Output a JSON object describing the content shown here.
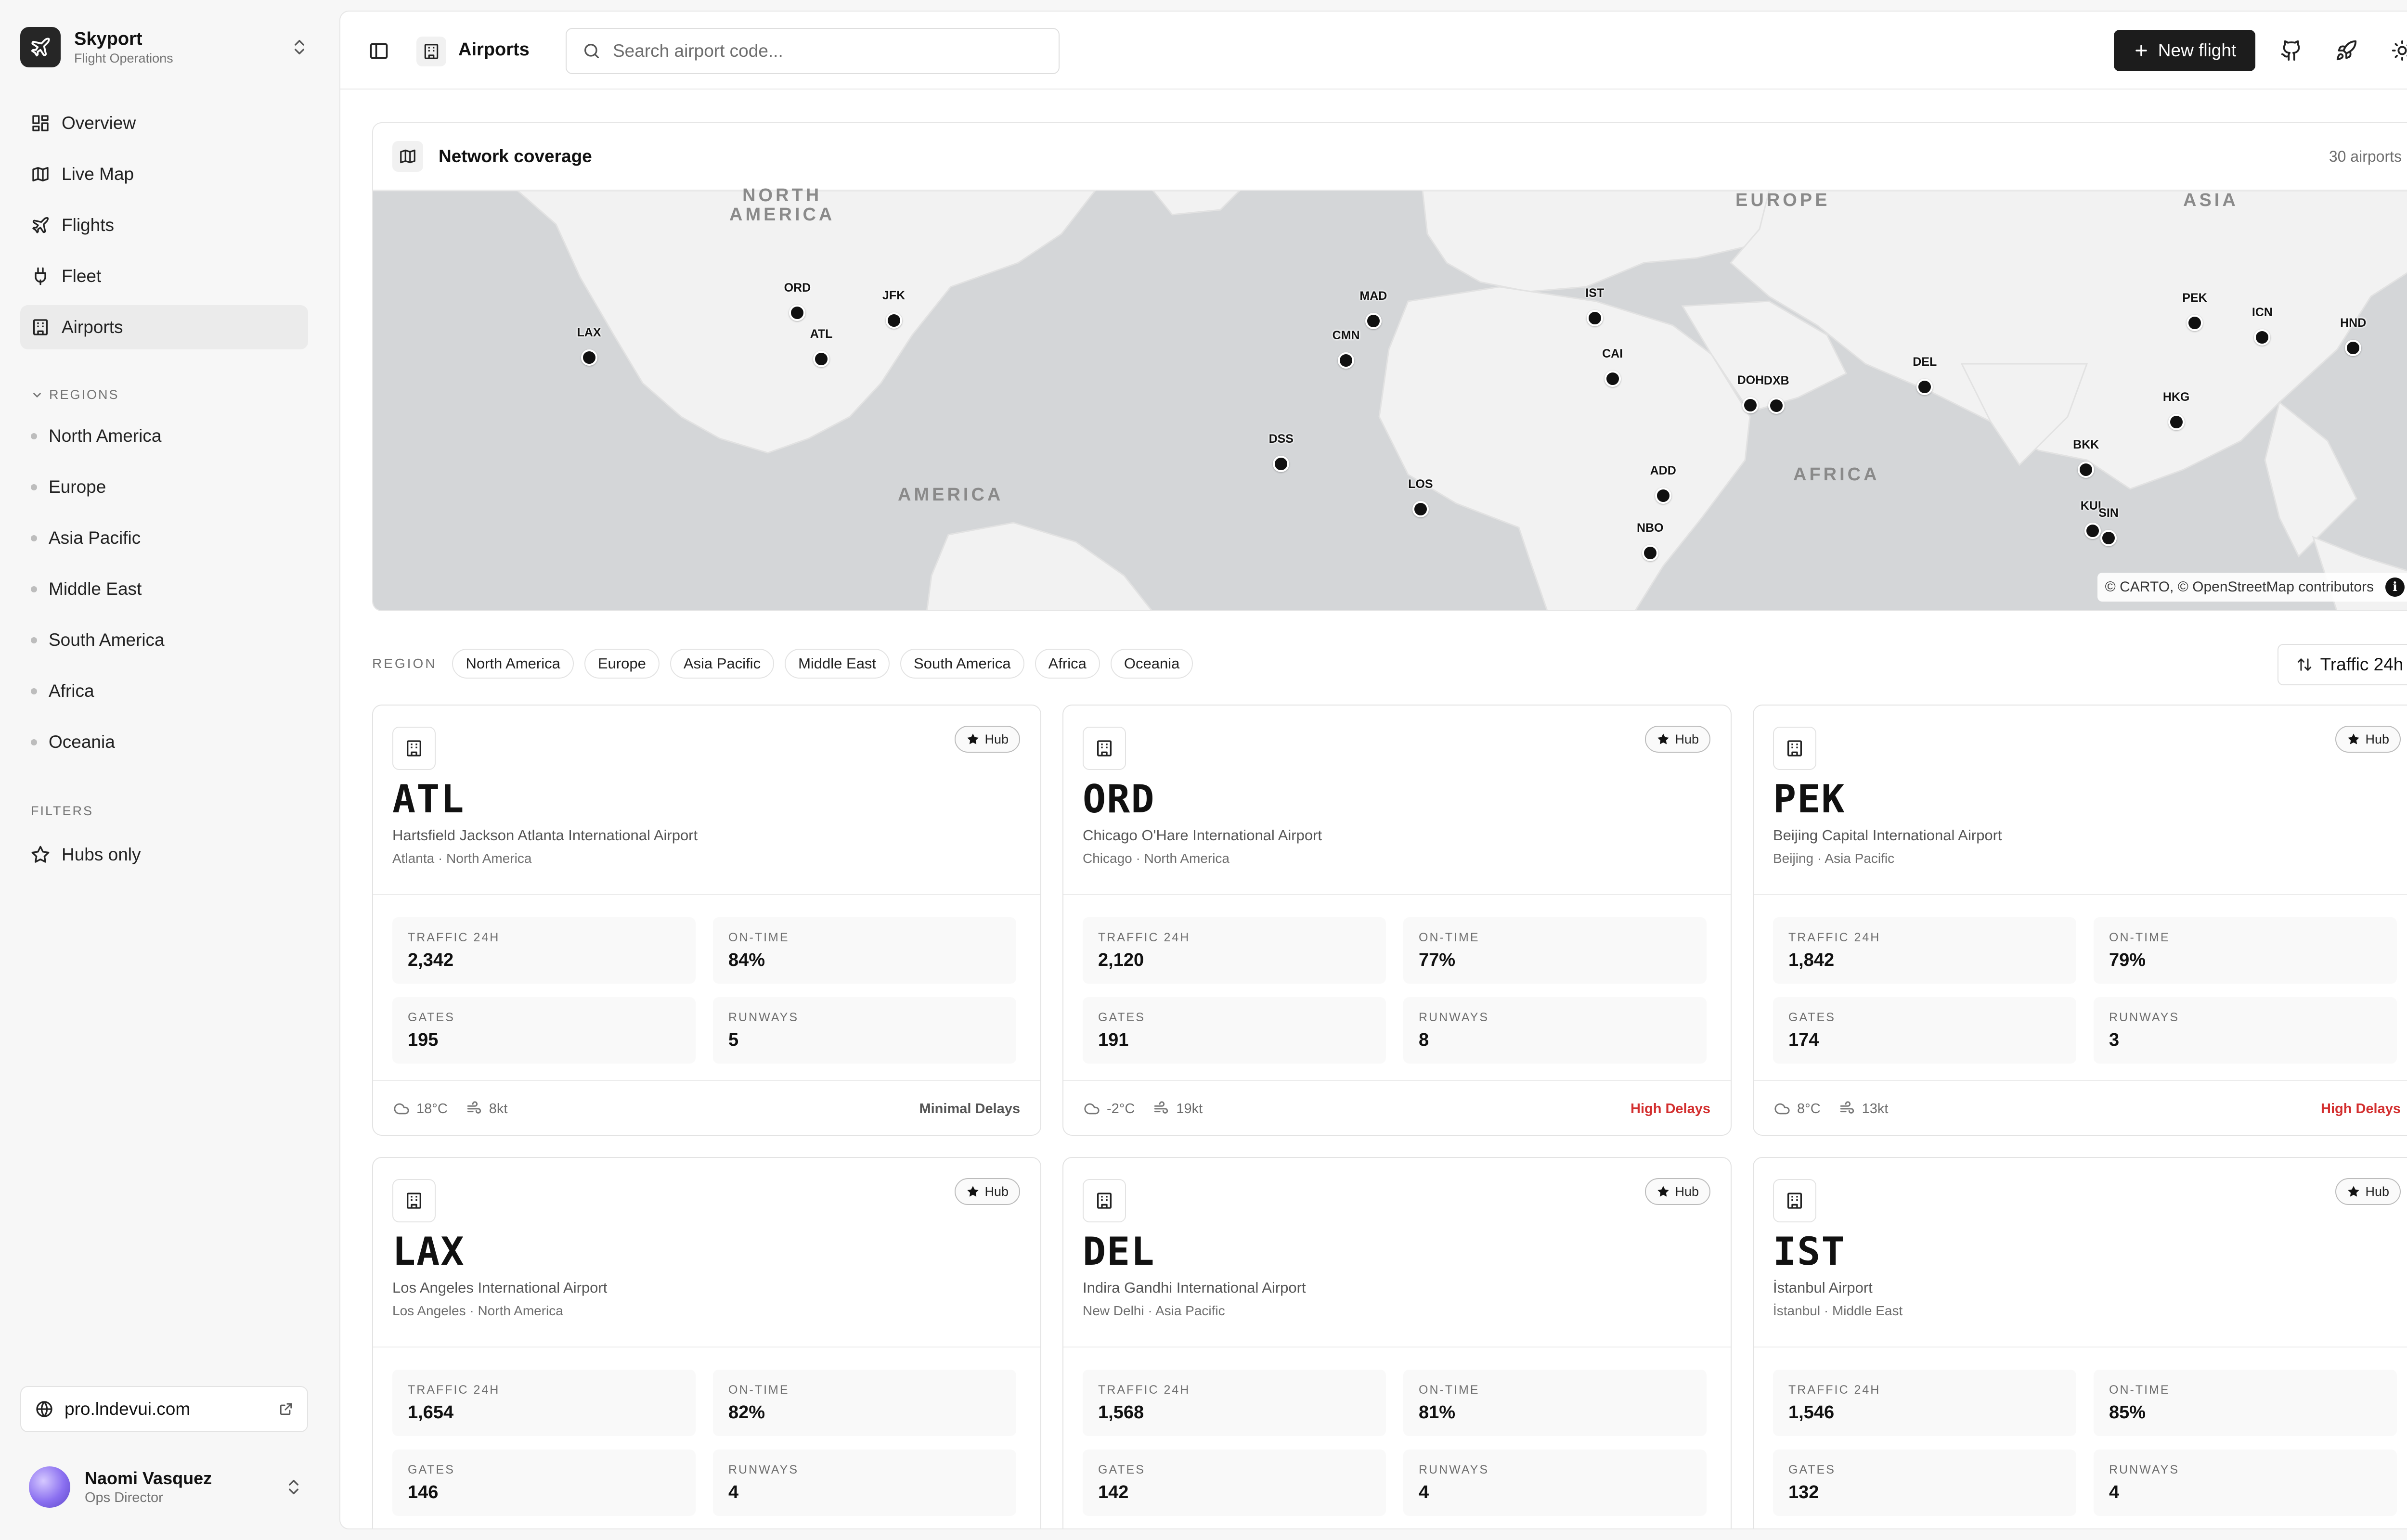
{
  "app": {
    "name": "Skyport",
    "subtitle": "Flight Operations"
  },
  "nav": [
    {
      "label": "Overview",
      "icon": "grid-icon",
      "active": false
    },
    {
      "label": "Live Map",
      "icon": "map-icon",
      "active": false
    },
    {
      "label": "Flights",
      "icon": "plane-icon",
      "active": false
    },
    {
      "label": "Fleet",
      "icon": "plug-icon",
      "active": false
    },
    {
      "label": "Airports",
      "icon": "building-icon",
      "active": true
    }
  ],
  "regions_section": {
    "label": "REGIONS"
  },
  "regions": [
    "North America",
    "Europe",
    "Asia Pacific",
    "Middle East",
    "South America",
    "Africa",
    "Oceania"
  ],
  "filters_section": {
    "label": "FILTERS"
  },
  "filters": {
    "hubs_only": "Hubs only"
  },
  "site_link": {
    "label": "pro.lndevui.com"
  },
  "user": {
    "name": "Naomi Vasquez",
    "role": "Ops Director"
  },
  "header": {
    "title": "Airports",
    "search_placeholder": "Search airport code...",
    "new_flight": "New flight"
  },
  "map": {
    "title": "Network coverage",
    "count": "30 airports",
    "attribution": "© CARTO, © OpenStreetMap contributors",
    "info": "i",
    "labels": {
      "north_america": "NORTH\nAMERICA",
      "europe": "EUROPE",
      "asia": "ASIA",
      "africa": "AFRICA",
      "america": "AMERICA"
    },
    "pins": [
      {
        "code": "LAX",
        "lon": -118.4,
        "lat": 33.9
      },
      {
        "code": "ORD",
        "lon": -87.9,
        "lat": 41.97
      },
      {
        "code": "JFK",
        "lon": -73.8,
        "lat": 40.6
      },
      {
        "code": "ATL",
        "lon": -84.4,
        "lat": 33.6
      },
      {
        "code": "MAD",
        "lon": -3.6,
        "lat": 40.5
      },
      {
        "code": "CMN",
        "lon": -7.6,
        "lat": 33.4
      },
      {
        "code": "IST",
        "lon": 28.8,
        "lat": 41.0
      },
      {
        "code": "CAI",
        "lon": 31.4,
        "lat": 30.1
      },
      {
        "code": "DOH",
        "lon": 51.6,
        "lat": 25.3
      },
      {
        "code": "DXB",
        "lon": 55.4,
        "lat": 25.25
      },
      {
        "code": "DEL",
        "lon": 77.1,
        "lat": 28.6
      },
      {
        "code": "PEK",
        "lon": 116.6,
        "lat": 40.1
      },
      {
        "code": "ICN",
        "lon": 126.5,
        "lat": 37.5
      },
      {
        "code": "HND",
        "lon": 139.8,
        "lat": 35.6
      },
      {
        "code": "HKG",
        "lon": 113.9,
        "lat": 22.3
      },
      {
        "code": "BKK",
        "lon": 100.7,
        "lat": 13.7
      },
      {
        "code": "KUL",
        "lon": 101.7,
        "lat": 2.7
      },
      {
        "code": "SIN",
        "lon": 104.0,
        "lat": 1.35
      },
      {
        "code": "ADD",
        "lon": 38.8,
        "lat": 9.0
      },
      {
        "code": "NBO",
        "lon": 36.9,
        "lat": -1.3
      },
      {
        "code": "DSS",
        "lon": -17.1,
        "lat": 14.7
      },
      {
        "code": "LOS",
        "lon": 3.3,
        "lat": 6.6
      }
    ]
  },
  "region_bar": {
    "label": "REGION",
    "chips": [
      "North America",
      "Europe",
      "Asia Pacific",
      "Middle East",
      "South America",
      "Africa",
      "Oceania"
    ],
    "sort": "Traffic 24h"
  },
  "stat_labels": {
    "traffic": "TRAFFIC 24H",
    "ontime": "ON-TIME",
    "gates": "GATES",
    "runways": "RUNWAYS"
  },
  "airports": [
    {
      "code": "ATL",
      "name": "Hartsfield Jackson Atlanta International Airport",
      "location": "Atlanta · North America",
      "hub": "Hub",
      "traffic": "2,342",
      "ontime": "84%",
      "gates": "195",
      "runways": "5",
      "temp": "18°C",
      "wind": "8kt",
      "delay": "Minimal Delays",
      "delay_level": "minimal"
    },
    {
      "code": "ORD",
      "name": "Chicago O'Hare International Airport",
      "location": "Chicago · North America",
      "hub": "Hub",
      "traffic": "2,120",
      "ontime": "77%",
      "gates": "191",
      "runways": "8",
      "temp": "-2°C",
      "wind": "19kt",
      "delay": "High Delays",
      "delay_level": "high"
    },
    {
      "code": "PEK",
      "name": "Beijing Capital International Airport",
      "location": "Beijing · Asia Pacific",
      "hub": "Hub",
      "traffic": "1,842",
      "ontime": "79%",
      "gates": "174",
      "runways": "3",
      "temp": "8°C",
      "wind": "13kt",
      "delay": "High Delays",
      "delay_level": "high"
    },
    {
      "code": "LAX",
      "name": "Los Angeles International Airport",
      "location": "Los Angeles · North America",
      "hub": "Hub",
      "traffic": "1,654",
      "ontime": "82%",
      "gates": "146",
      "runways": "4"
    },
    {
      "code": "DEL",
      "name": "Indira Gandhi International Airport",
      "location": "New Delhi · Asia Pacific",
      "hub": "Hub",
      "traffic": "1,568",
      "ontime": "81%",
      "gates": "142",
      "runways": "4"
    },
    {
      "code": "IST",
      "name": "İstanbul Airport",
      "location": "İstanbul · Middle East",
      "hub": "Hub",
      "traffic": "1,546",
      "ontime": "85%",
      "gates": "132",
      "runways": "4"
    }
  ]
}
